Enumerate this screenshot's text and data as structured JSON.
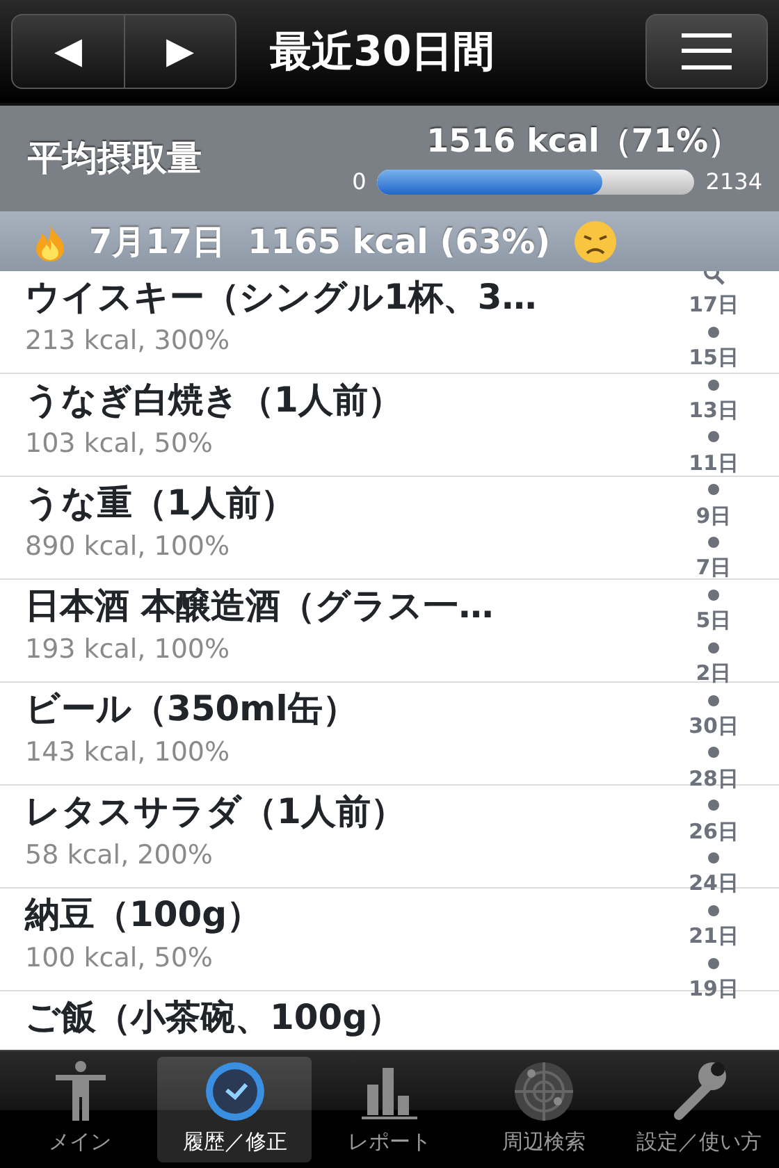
{
  "navbar": {
    "title": "最近30日間",
    "prev": "◀",
    "next": "▶"
  },
  "summary": {
    "label": "平均摂取量",
    "value": "1516 kcal（71%）",
    "min": "0",
    "max": "2134",
    "level": 0.71
  },
  "section": {
    "date": "7月17日",
    "total": "1165 kcal (63%)"
  },
  "entries": [
    {
      "name": "ウイスキー（シングル1杯、3…",
      "detail": "213 kcal, 300%"
    },
    {
      "name": "うなぎ白焼き（1人前）",
      "detail": "103 kcal, 50%"
    },
    {
      "name": "うな重（1人前）",
      "detail": "890 kcal, 100%"
    },
    {
      "name": "日本酒 本醸造酒（グラス一…",
      "detail": "193 kcal, 100%"
    },
    {
      "name": "ビール（350ml缶）",
      "detail": "143 kcal, 100%"
    },
    {
      "name": "レタスサラダ（1人前）",
      "detail": "58 kcal, 200%"
    },
    {
      "name": "納豆（100g）",
      "detail": "100 kcal, 50%"
    },
    {
      "name": "ご飯（小茶碗、100g）"
    }
  ],
  "index": [
    "17日",
    "15日",
    "13日",
    "11日",
    "9日",
    "7日",
    "5日",
    "2日",
    "30日",
    "28日",
    "26日",
    "24日",
    "21日",
    "19日"
  ],
  "tabs": [
    {
      "label": "メイン",
      "kind": "person",
      "selected": false
    },
    {
      "label": "履歴／修正",
      "kind": "clock",
      "selected": true
    },
    {
      "label": "レポート",
      "kind": "chart",
      "selected": false
    },
    {
      "label": "周辺検索",
      "kind": "radar",
      "selected": false
    },
    {
      "label": "設定／使い方",
      "kind": "wrench",
      "selected": false
    }
  ]
}
